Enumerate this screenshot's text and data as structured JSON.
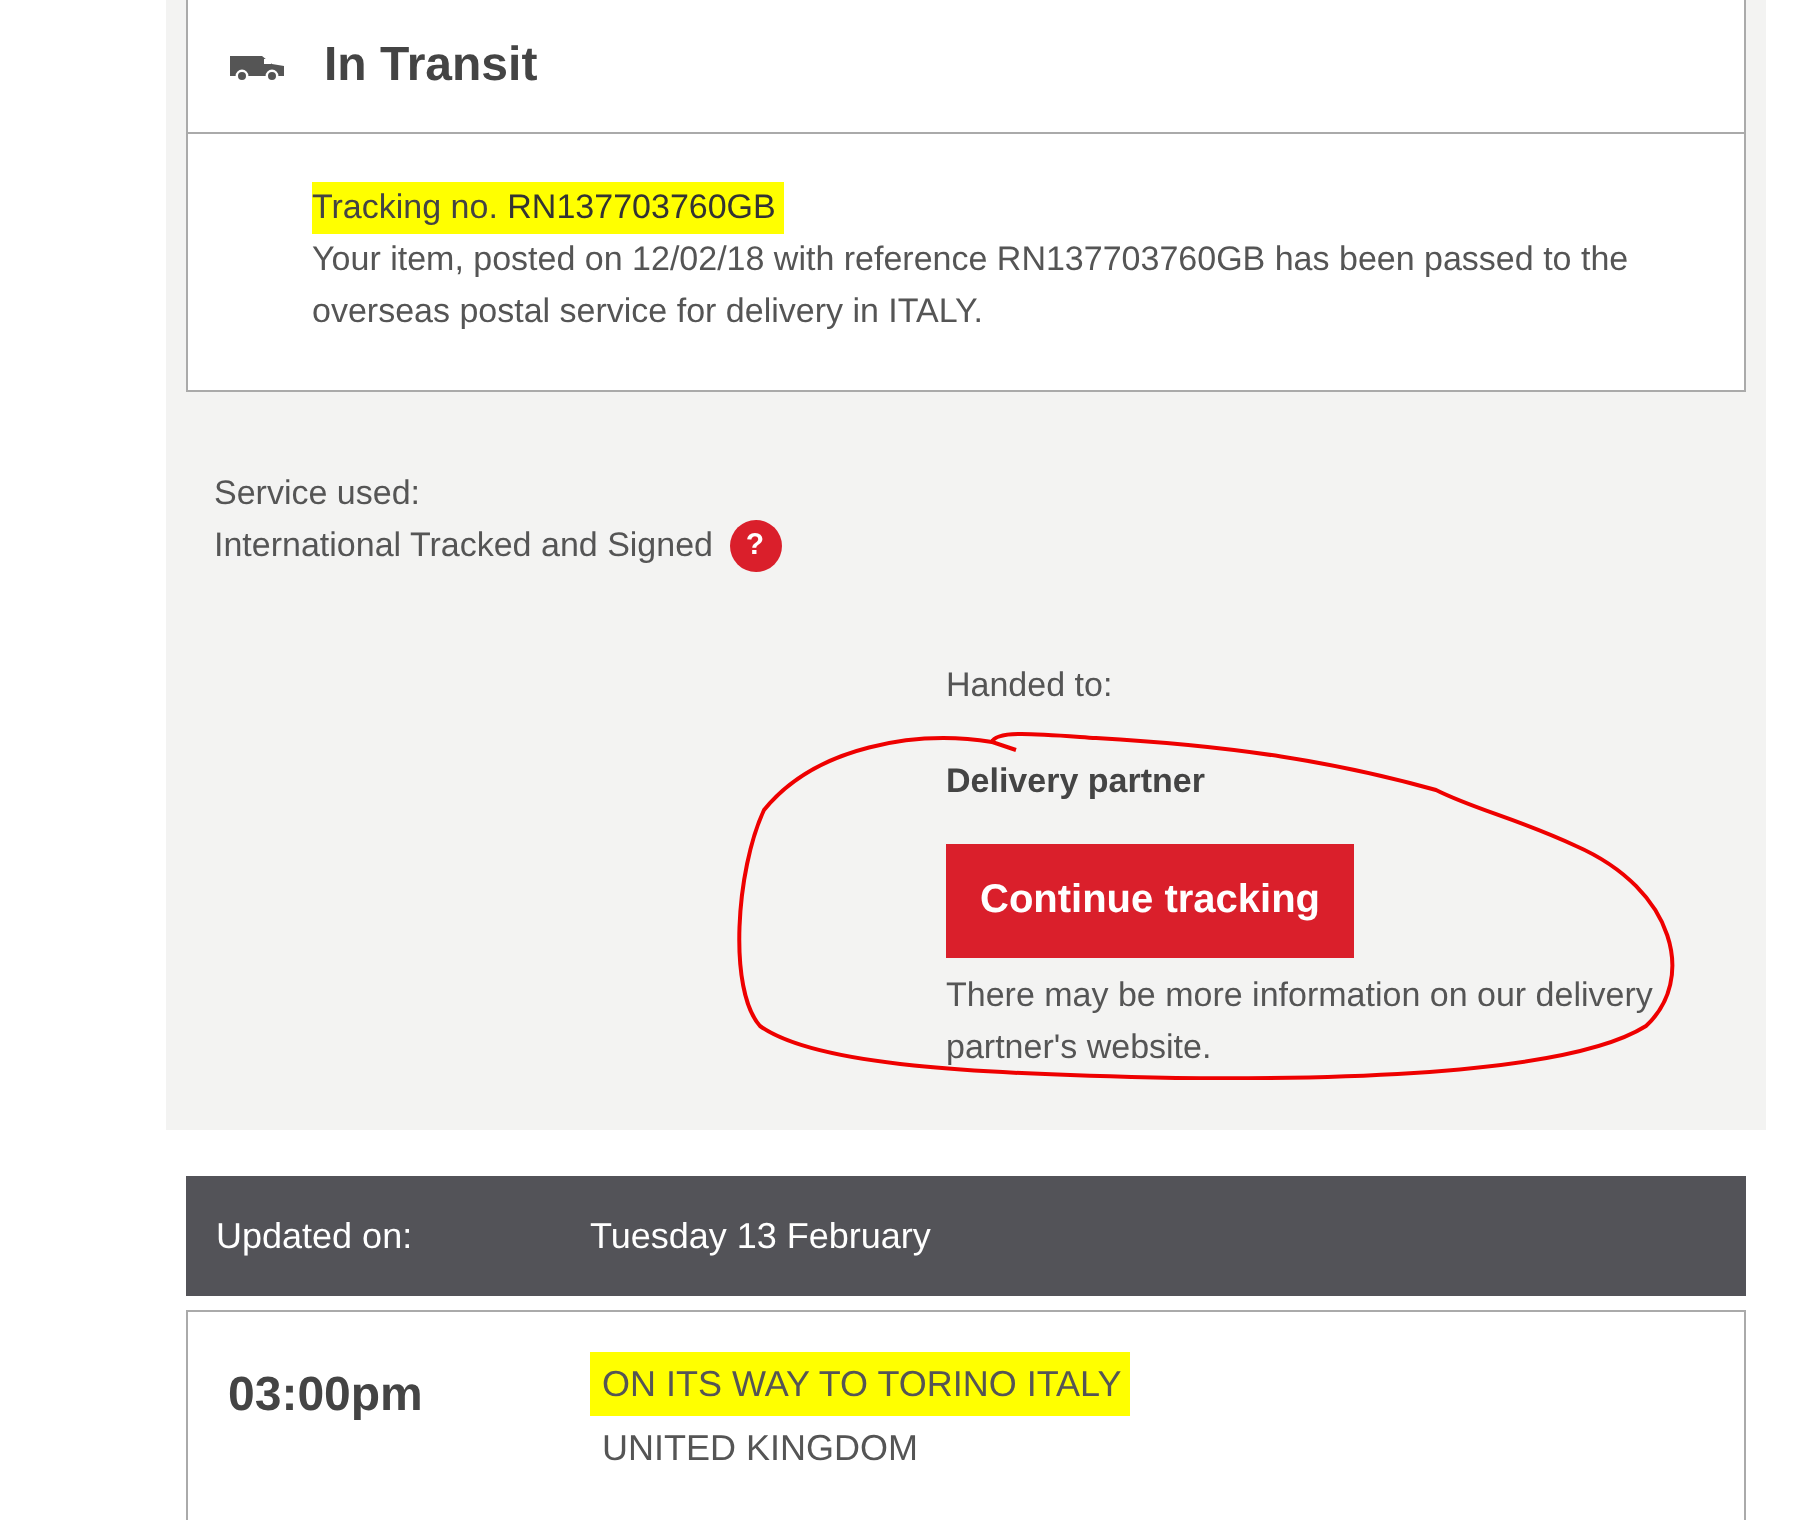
{
  "status_card": {
    "title": "In Transit",
    "tracking_label": "Tracking no.",
    "tracking_number": "RN137703760GB",
    "highlighted": true,
    "message": "Your item, posted on 12/02/18 with reference RN137703760GB has been passed to the overseas postal service for delivery in ITALY."
  },
  "service": {
    "label": "Service used:",
    "value": "International Tracked and Signed",
    "help_icon": "?"
  },
  "handed_to": {
    "label": "Handed to:",
    "partner": "Delivery partner",
    "button": "Continue tracking",
    "note": "There may be more information on our delivery partner's website.",
    "circled": true
  },
  "updates": {
    "label": "Updated on:",
    "date": "Tuesday 13 February",
    "events": [
      {
        "time": "03:00pm",
        "status": "ON ITS WAY TO TORINO ITALY",
        "highlighted": true,
        "location": "UNITED KINGDOM"
      }
    ]
  }
}
